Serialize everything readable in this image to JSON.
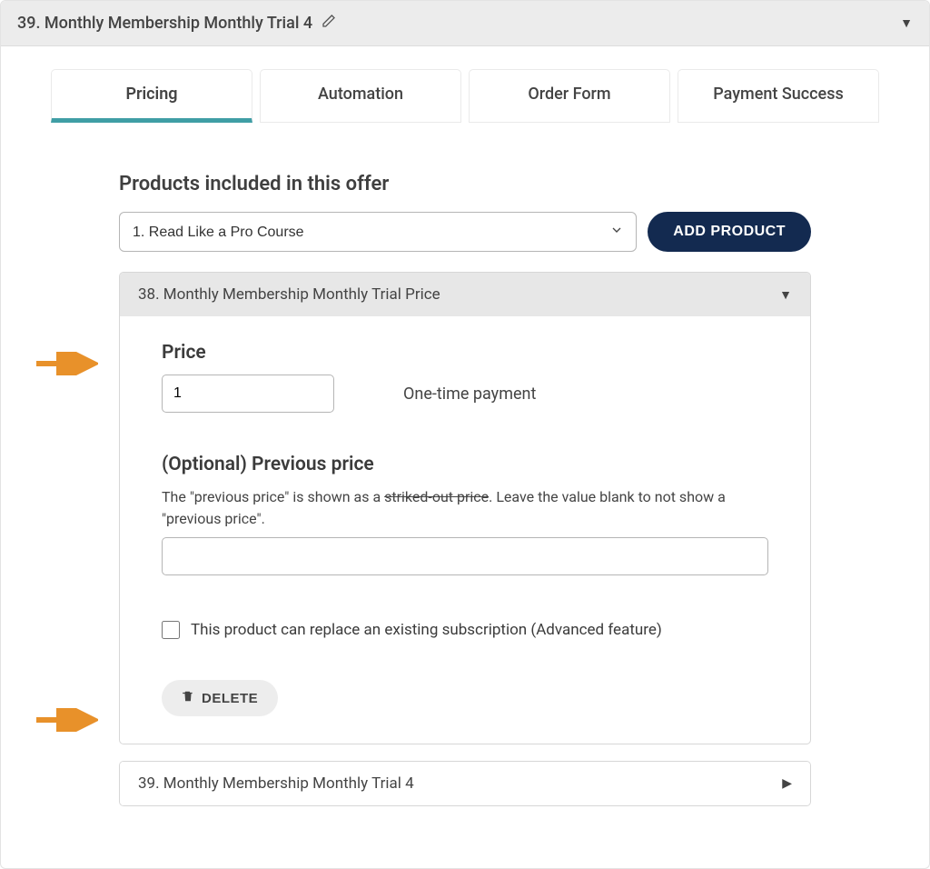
{
  "header": {
    "title": "39.  Monthly Membership Monthly Trial 4"
  },
  "tabs": {
    "pricing": "Pricing",
    "automation": "Automation",
    "order_form": "Order Form",
    "payment_success": "Payment Success"
  },
  "products": {
    "section_title": "Products included in this offer",
    "selected_option": "1. Read Like a Pro Course",
    "add_button": "ADD PRODUCT"
  },
  "accordion1": {
    "title": "38. Monthly Membership Monthly Trial Price",
    "price_label": "Price",
    "price_value": "1",
    "payment_type": "One-time payment",
    "prev_label": "(Optional) Previous price",
    "prev_help_a": "The \"previous price\" is shown as a ",
    "prev_help_b": "striked-out price",
    "prev_help_c": ". Leave the value blank to not show a \"previous price\".",
    "replace_label": "This product can replace an existing subscription (Advanced feature)",
    "delete_label": "DELETE"
  },
  "accordion2": {
    "title": "39. Monthly Membership Monthly Trial 4"
  }
}
